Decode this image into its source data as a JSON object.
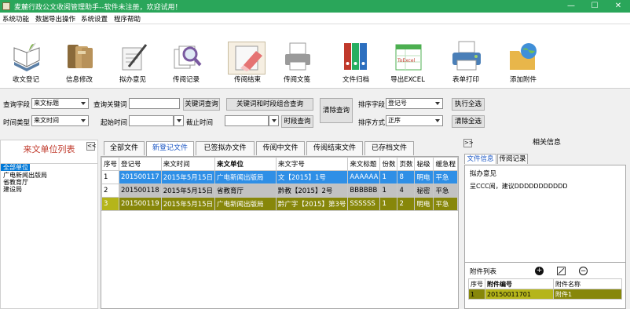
{
  "window": {
    "title": "麦麓行政公文收阅管理助手--软件未注册，欢迎试用！",
    "controls": [
      "—",
      "☐",
      "✕"
    ]
  },
  "menu": [
    "系统功能",
    "数据导出操作",
    "系统设置",
    "程序帮助"
  ],
  "toolbar": [
    {
      "label": "收文登记",
      "icon": "register-book-icon"
    },
    {
      "label": "信息修改",
      "icon": "folders-edit-icon"
    },
    {
      "label": "拟办意见",
      "icon": "pen-paper-icon"
    },
    {
      "label": "传阅记录",
      "icon": "magnifier-docs-icon"
    },
    {
      "label": "传阅结束",
      "icon": "eraser-icon"
    },
    {
      "label": "传阅文笺",
      "icon": "printer-note-icon"
    },
    {
      "label": "文件归档",
      "icon": "binders-icon"
    },
    {
      "label": "导出EXCEL",
      "icon": "excel-export-icon",
      "badge": "ToExcel"
    },
    {
      "label": "表单打印",
      "icon": "printer-icon"
    },
    {
      "label": "添加附件",
      "icon": "globe-folder-icon"
    }
  ],
  "search": {
    "field_label": "查询字段",
    "field_value": "来文标题",
    "keyword_label": "查询关键词",
    "keyword_value": "",
    "keyword_btn": "关键词查询",
    "combined_btn": "关键词和时段组合查询",
    "clear_btn": "清除查询",
    "sort_field_label": "排序字段",
    "sort_field_value": "登记号",
    "exec_sort_btn": "执行全选",
    "time_type_label": "时间类型",
    "time_type_value": "来文时间",
    "start_label": "起始时间",
    "start_value": "",
    "end_label": "截止时间",
    "end_value": "",
    "period_btn": "时段查询",
    "sort_order_label": "排序方式",
    "sort_order_value": "正序",
    "clear_all_btn": "清除全选"
  },
  "left": {
    "header": "来文单位列表",
    "collapse": "<<",
    "items": [
      "全部单位",
      "广电新闻出版局",
      "省教育厅",
      "建设局"
    ],
    "selected_index": 0
  },
  "tabs": [
    "全部文件",
    "新登记文件",
    "已签拟办文件",
    "传阅中文件",
    "传阅结束文件",
    "已存档文件"
  ],
  "active_tab": 1,
  "grid": {
    "columns": [
      "序号",
      "登记号",
      "来文时间",
      "来文单位",
      "来文字号",
      "来文标题",
      "份数",
      "页数",
      "秘级",
      "缓急程"
    ],
    "rows": [
      [
        "1",
        "201500117",
        "2015年5月15日",
        "广电新闻出版局",
        "文【2015】1号",
        "AAAAAA",
        "1",
        "8",
        "明电",
        "平急"
      ],
      [
        "2",
        "201500118",
        "2015年5月15日",
        "省教育厅",
        "黔教【2015】2号",
        "BBBBBB",
        "1",
        "4",
        "秘密",
        "平急"
      ],
      [
        "3",
        "201500119",
        "2015年5月15日",
        "广电新闻出版局",
        "黔广字【2015】第3号",
        "SSSSSS",
        "1",
        "2",
        "明电",
        "平急"
      ]
    ],
    "row_colors": [
      "#2f8fe6",
      "#c2c2c2",
      "#87870a"
    ],
    "row_text_colors": [
      "#ffffff",
      "#000000",
      "#ffffff"
    ]
  },
  "right": {
    "expand": ">>",
    "header": "相关信息",
    "tabs": [
      "文件信息",
      "传阅记录"
    ],
    "opinion_label": "拟办意见",
    "opinion_text": "呈CCC阅，建议DDDDDDDDDDD",
    "attachments_label": "附件列表",
    "attachments_columns": [
      "序号",
      "附件编号",
      "附件名称"
    ],
    "attachments": [
      [
        "1",
        "20150011701",
        "附件1"
      ]
    ]
  }
}
